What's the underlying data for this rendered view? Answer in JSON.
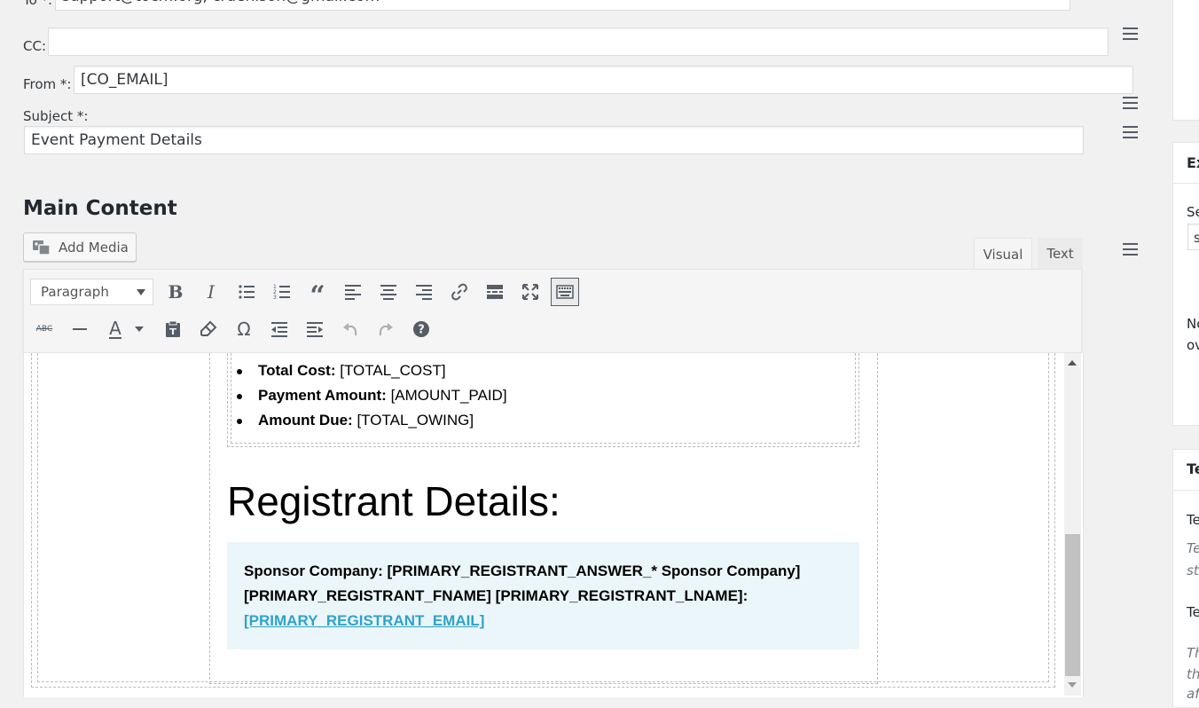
{
  "fields": {
    "to_label": "To *:",
    "to_value": "support@tocm.org, crdenison@gmail.com",
    "cc_label": "CC:",
    "cc_value": "",
    "from_label": "From *:",
    "from_value": "[CO_EMAIL]",
    "subject_label": "Subject *:",
    "subject_value": "Event Payment Details"
  },
  "main_content": {
    "title": "Main Content",
    "add_media_label": "Add Media",
    "tabs": {
      "visual": "Visual",
      "text": "Text"
    },
    "format_select": "Paragraph"
  },
  "editor": {
    "list_items": [
      {
        "label": "Total Cost:",
        "value": "[TOTAL_COST]"
      },
      {
        "label": "Payment Amount:",
        "value": "[AMOUNT_PAID]"
      },
      {
        "label": "Amount Due:",
        "value": "[TOTAL_OWING]"
      }
    ],
    "registrant_heading": "Registrant Details:",
    "registrant_line1": "Sponsor Company: [PRIMARY_REGISTRANT_ANSWER_* Sponsor Company]",
    "registrant_line2": "[PRIMARY_REGISTRANT_FNAME] [PRIMARY_REGISTRANT_LNAME]:",
    "registrant_email": "[PRIMARY_REGISTRANT_EMAIL]"
  },
  "sidebar_fragments": {
    "box2_title": "Ex",
    "box2_label": "Se",
    "box2_select": "s",
    "box2_note1": "No",
    "box2_note2": "ov",
    "box3_title": "Te",
    "box3_line1": "Te",
    "box3_italic1": "Te",
    "box3_italic2": "st",
    "box3_line2": "Te",
    "box3_italic3": "Th",
    "box3_italic4": "th",
    "box3_italic5": "af"
  },
  "icons": [
    "hamburger-icon",
    "bold-icon",
    "italic-icon",
    "bullet-list-icon",
    "numbered-list-icon",
    "blockquote-icon",
    "align-left-icon",
    "align-center-icon",
    "align-right-icon",
    "link-icon",
    "read-more-icon",
    "fullscreen-icon",
    "toolbar-toggle-icon",
    "strikethrough-icon",
    "horizontal-line-icon",
    "text-color-icon",
    "paste-text-icon",
    "clear-formatting-icon",
    "special-char-icon",
    "outdent-icon",
    "indent-icon",
    "undo-icon",
    "redo-icon",
    "help-icon"
  ]
}
